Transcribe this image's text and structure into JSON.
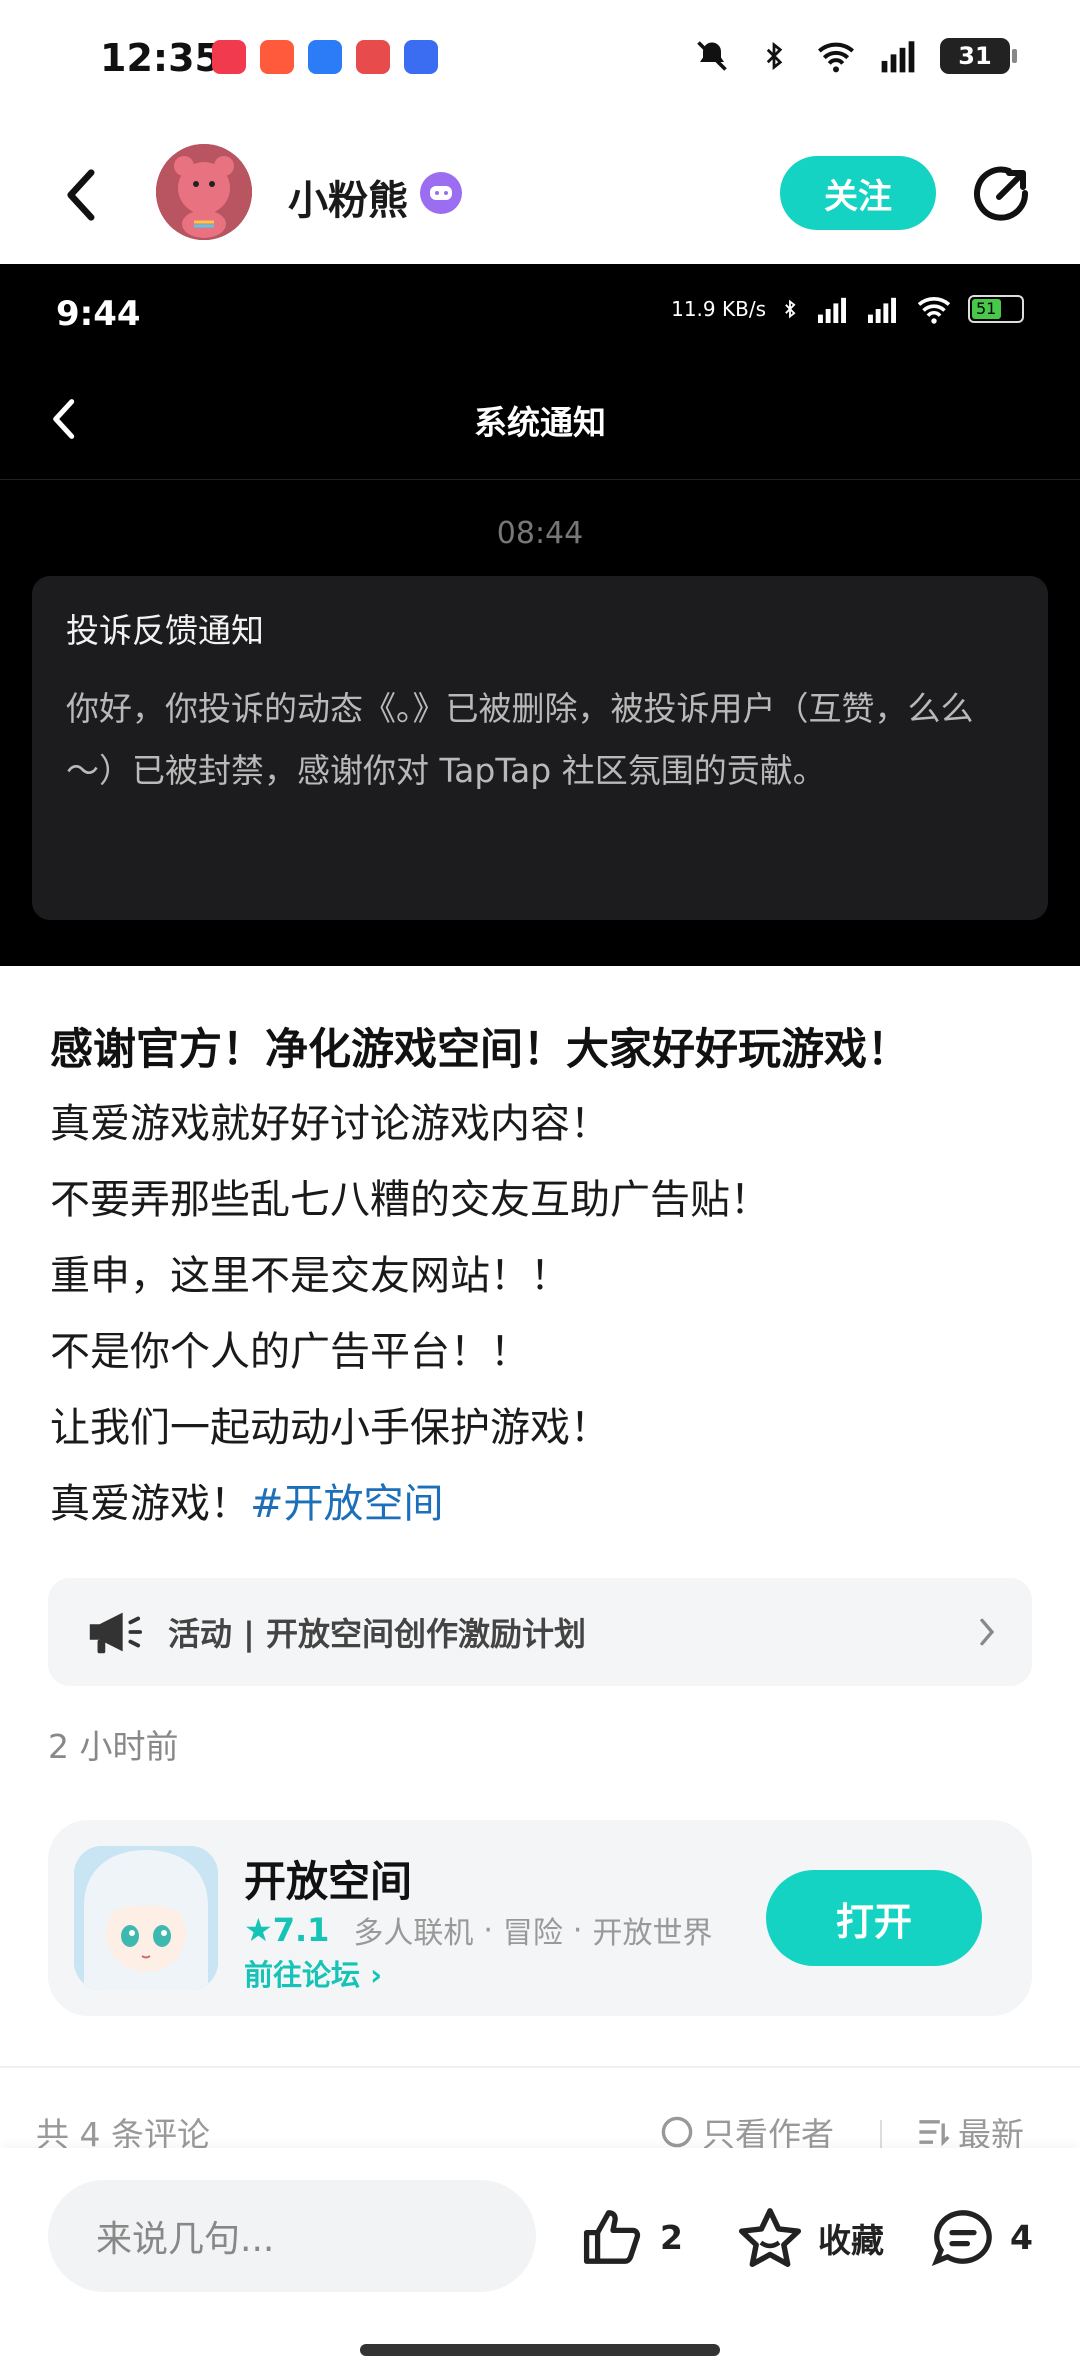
{
  "status_bar": {
    "time": "12:35",
    "battery": "31",
    "app_colors": [
      "#f23a4f",
      "#ff5a3c",
      "#2b7cf6",
      "#e84b4b",
      "#3b6df2"
    ]
  },
  "header": {
    "author_name": "小粉熊",
    "follow_label": "关注"
  },
  "embedded_screenshot": {
    "time": "9:44",
    "net_speed": "11.9 KB/s",
    "battery": "51",
    "title": "系统通知",
    "timestamp": "08:44",
    "notice_title": "投诉反馈通知",
    "notice_body": "你好，你投诉的动态《。》已被删除，被投诉用户（互赞，么么～）已被封禁，感谢你对 TapTap 社区氛围的贡献。"
  },
  "post": {
    "title": "感谢官方！净化游戏空间！大家好好玩游戏！",
    "lines": [
      "真爱游戏就好好讨论游戏内容！",
      "不要弄那些乱七八糟的交友互助广告贴！",
      "重申，这里不是交友网站！！",
      "不是你个人的广告平台！！",
      "让我们一起动动小手保护游戏！"
    ],
    "last_line_text": "真爱游戏！",
    "hashtag": "#开放空间"
  },
  "activity": {
    "label": "活动 | 开放空间创作激励计划"
  },
  "post_time": "2 小时前",
  "game_card": {
    "name": "开放空间",
    "rating": "7.1",
    "tags": [
      "多人联机",
      "·",
      "冒险",
      "·",
      "开放世界"
    ],
    "forum_link": "前往论坛",
    "open_label": "打开"
  },
  "comments": {
    "count_label": "共 4 条评论",
    "filter_label": "只看作者",
    "sort_label": "最新"
  },
  "bottom_bar": {
    "input_placeholder": "来说几句...",
    "like_count": "2",
    "favorite_label": "收藏",
    "comment_count": "4"
  },
  "colors": {
    "accent": "#15d3c3",
    "hashtag": "#1c6fb8"
  }
}
